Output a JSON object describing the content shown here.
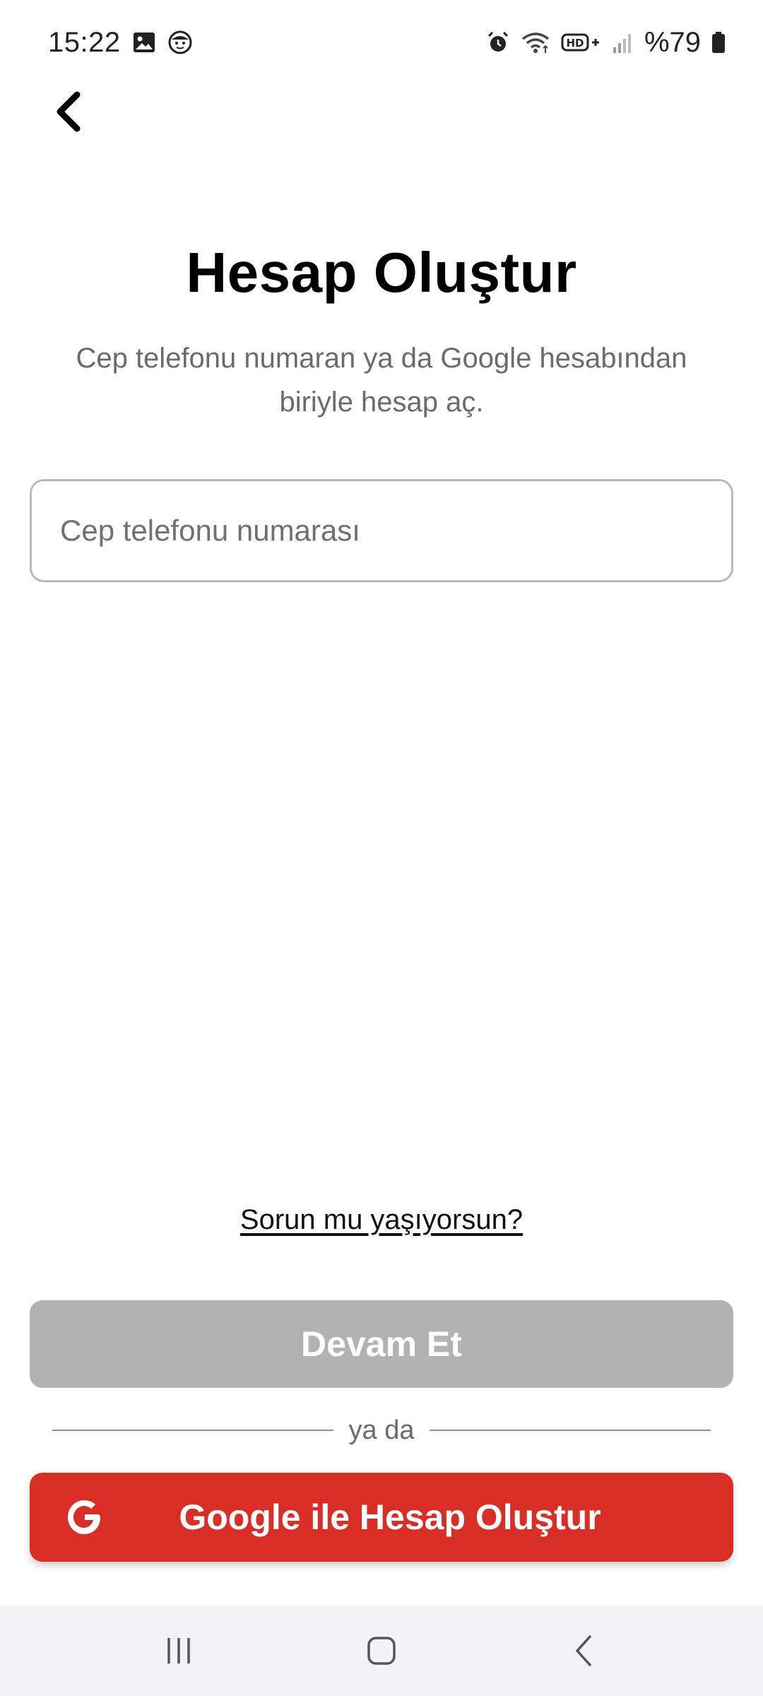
{
  "status_bar": {
    "time": "15:22",
    "battery_text": "%79",
    "left_icons": [
      "image-icon",
      "face-icon"
    ],
    "right_icons": [
      "alarm-icon",
      "wifi-icon",
      "hd-plus-icon",
      "signal-icon",
      "battery-icon"
    ],
    "hd_label": "HD+"
  },
  "header": {
    "back_icon": "chevron-left-icon"
  },
  "main": {
    "title": "Hesap Oluştur",
    "subtitle": "Cep telefonu numaran ya da Google hesabından biriyle hesap aç.",
    "phone_input": {
      "placeholder": "Cep telefonu numarası",
      "value": ""
    },
    "help_link": "Sorun mu yaşıyorsun?",
    "continue_button": "Devam Et",
    "divider_text": "ya da",
    "google_button": "Google ile Hesap Oluştur",
    "google_icon": "google-g-icon"
  },
  "nav_bar": {
    "items": [
      "recents-icon",
      "home-icon",
      "back-icon"
    ]
  },
  "colors": {
    "accent_red": "#d82e25",
    "disabled_gray": "#b2b2b2",
    "subtitle_gray": "#6b6b6b",
    "nav_bg": "#f3f3f5"
  }
}
